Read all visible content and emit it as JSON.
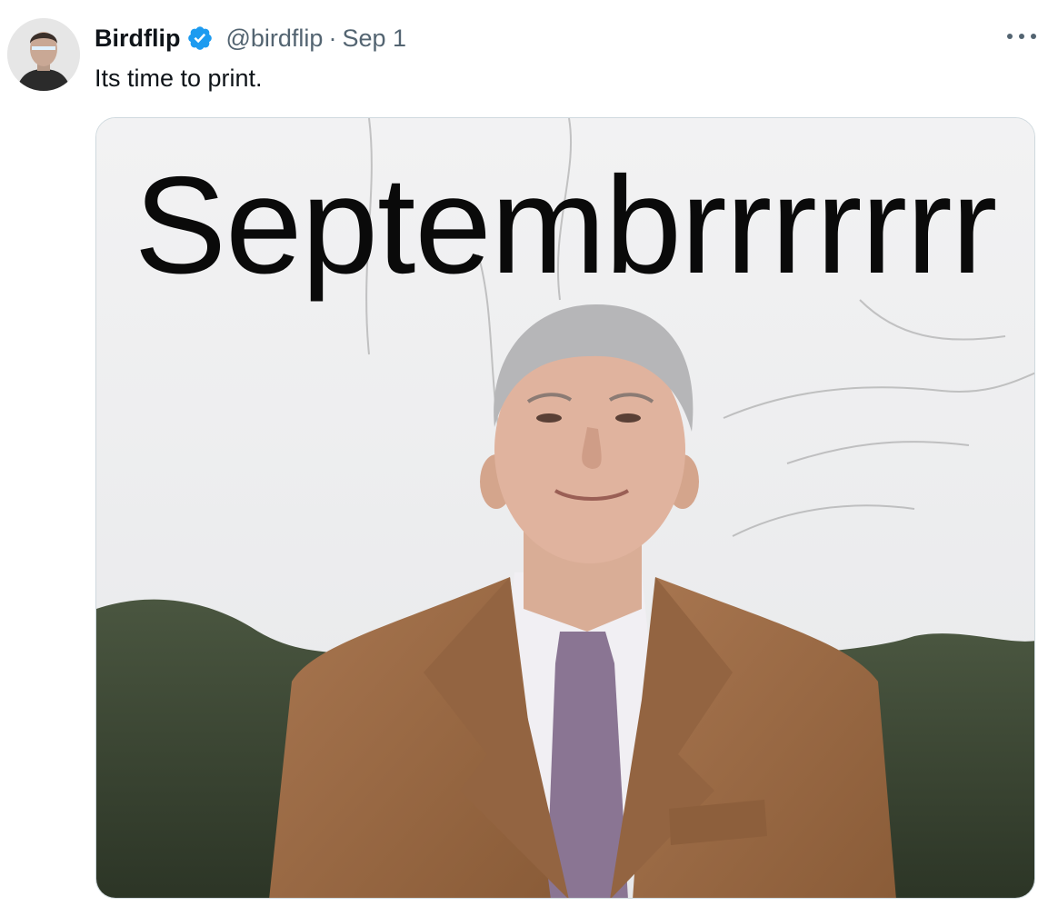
{
  "tweet": {
    "author": {
      "display_name": "Birdflip",
      "handle": "@birdflip",
      "verified_icon": "verified-badge-icon",
      "avatar": "avatar-icon"
    },
    "separator": "·",
    "date": "Sep 1",
    "text": "Its time to print.",
    "more_icon": "more-options-icon",
    "media": {
      "caption": "Septembrrrrrrr",
      "colors": {
        "sky": "#eeeeef",
        "coat": "#9c6b43",
        "tie": "#8a7593",
        "shirt": "#f1eff3",
        "hedge": "#3b4634"
      }
    }
  },
  "colors": {
    "text_primary": "#0f1419",
    "text_secondary": "#536471",
    "verified_blue": "#1d9bf0",
    "border": "#cfd9de"
  }
}
